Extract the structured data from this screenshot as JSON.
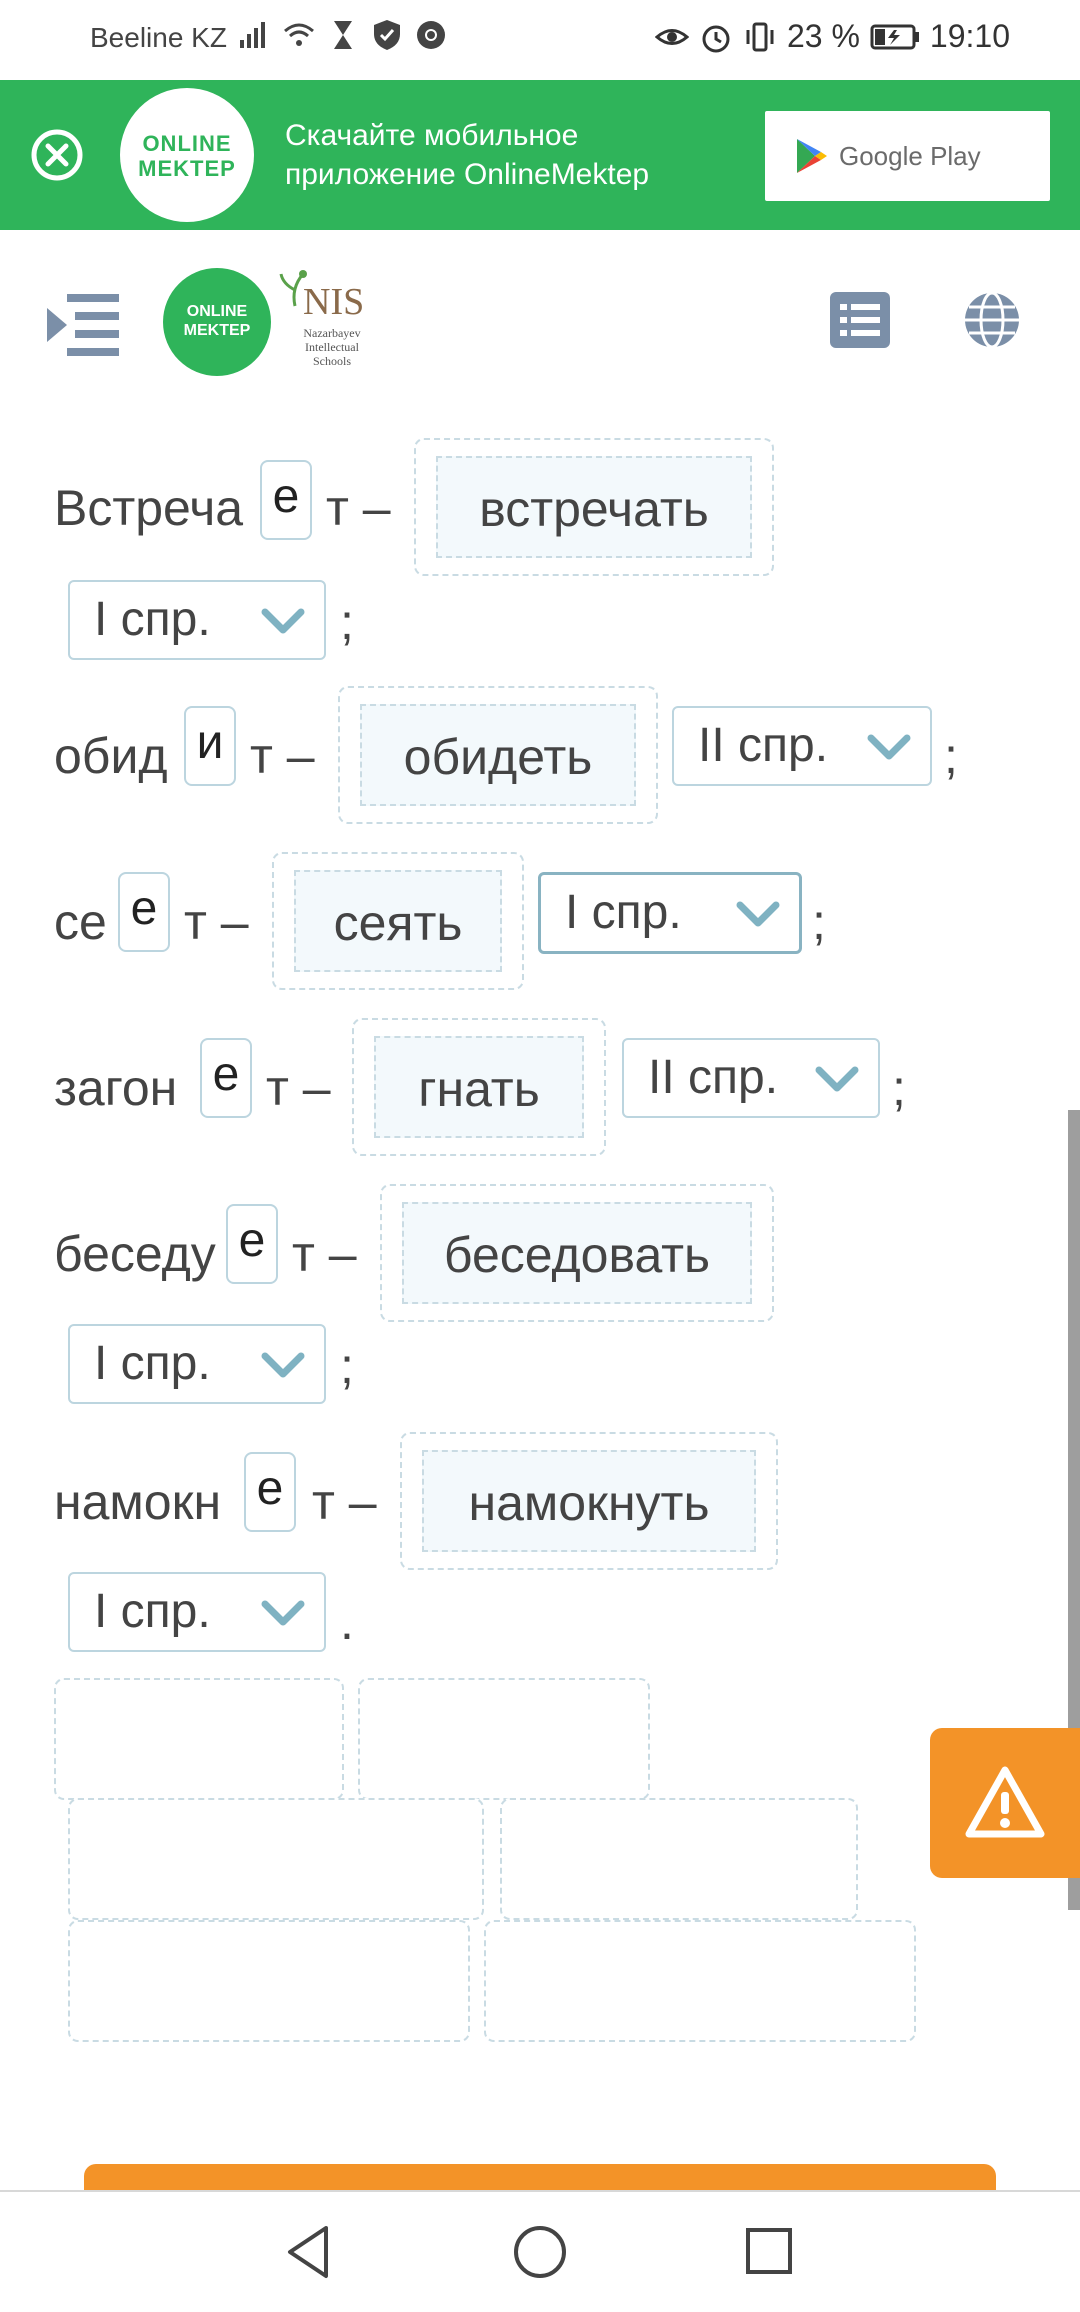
{
  "status_bar": {
    "carrier": "Beeline KZ",
    "battery": "23 %",
    "time": "19:10"
  },
  "promo": {
    "logo_line1": "ONLINE",
    "logo_line2": "MEKTEP",
    "text_line1": "Скачайте мобильное",
    "text_line2": "приложение OnlineMektep",
    "store_label": "Google Play"
  },
  "header": {
    "logo_line1": "ONLINE",
    "logo_line2": "MEKTEP",
    "nis_title": "NIS",
    "nis_sub1": "Nazarbayev",
    "nis_sub2": "Intellectual",
    "nis_sub3": "Schools"
  },
  "exercise": {
    "rows": [
      {
        "prefix": "Встреча",
        "letter": "е",
        "suffix": "т –",
        "infinitive": "встречать",
        "conjugation": "I спр.",
        "punct": ";"
      },
      {
        "prefix": "обид",
        "letter": "и",
        "suffix": "т –",
        "infinitive": "обидеть",
        "conjugation": "II спр.",
        "punct": ";"
      },
      {
        "prefix": "се",
        "letter": "е",
        "suffix": "т –",
        "infinitive": "сеять",
        "conjugation": "I спр.",
        "punct": ";"
      },
      {
        "prefix": "загон",
        "letter": "е",
        "suffix": "т –",
        "infinitive": "гнать",
        "conjugation": "II спр.",
        "punct": ";"
      },
      {
        "prefix": "беседу",
        "letter": "е",
        "suffix": "т –",
        "infinitive": "беседовать",
        "conjugation": "I спр.",
        "punct": ";"
      },
      {
        "prefix": "намокн",
        "letter": "е",
        "suffix": "т –",
        "infinitive": "намокнуть",
        "conjugation": "I спр.",
        "punct": "."
      }
    ]
  },
  "colors": {
    "brand_green": "#2fb45a",
    "accent_orange": "#f39328",
    "field_border": "#bcd5df",
    "chevron": "#7fb2c2"
  }
}
